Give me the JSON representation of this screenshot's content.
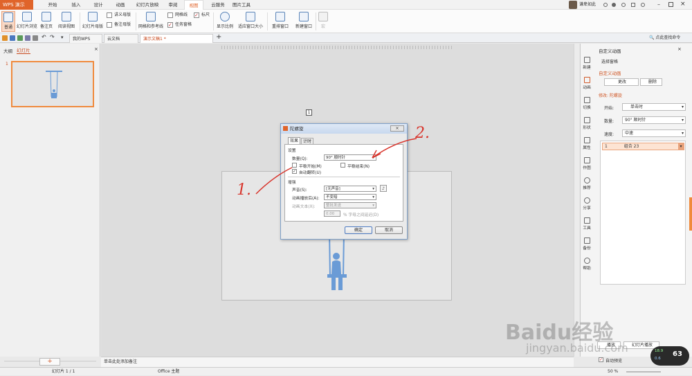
{
  "app": {
    "name": "WPS 演示",
    "user": "谦卑如此",
    "search_hint": "点此查找命令"
  },
  "menu": [
    "开始",
    "插入",
    "设计",
    "动画",
    "幻灯片放映",
    "审阅",
    "视图",
    "云服务",
    "图片工具"
  ],
  "menu_active": "视图",
  "ribbon": {
    "normal": "普通",
    "slide_browse": "幻灯片浏览",
    "notes_page": "备注页",
    "reading_view": "阅读视图",
    "slide_master": "幻灯片母版",
    "handout_master": "讲义母版",
    "notes_master": "备注母版",
    "grid_guides": "网格和参考线",
    "gridlines": "网格线",
    "ruler": "标尺",
    "task_pane": "任务窗格",
    "display_ratio": "显示比例",
    "fit_window": "适应窗口大小",
    "arrange_window": "重排窗口",
    "new_window": "新建窗口",
    "macro": "宏"
  },
  "doctabs": [
    "我的WPS",
    "云文档",
    "演示文稿1 *"
  ],
  "left_panel": {
    "tab_outline": "大纲",
    "tab_slides": "幻灯片",
    "slide_number": "1"
  },
  "canvas": {
    "marker": "1",
    "notes_hint": "单击此处添加备注"
  },
  "dialog": {
    "title": "陀螺旋",
    "tab_effect": "效果",
    "tab_timing": "计时",
    "group_settings": "设置",
    "amount_label": "数量(Q):",
    "amount_value": "90°  顺时针",
    "smooth_start": "平稳开始(M)",
    "smooth_end": "平稳结束(N)",
    "auto_reverse": "自动翻转(U)",
    "group_enhance": "增强",
    "sound_label": "声音(S):",
    "sound_value": "[无声音]",
    "after_anim_label": "动画播放后(A):",
    "after_anim_value": "不变暗",
    "anim_text_label": "动画文本(X):",
    "anim_text_value": "整批发送",
    "delay_value": "0.00",
    "delay_unit": "% 字母之间延迟(D)",
    "ok": "确定",
    "cancel": "取消"
  },
  "right_panel": {
    "header": "自定义动画",
    "select_pane": "选择窗格",
    "section_title": "自定义动画",
    "change_btn": "更改",
    "delete_btn": "删除",
    "modify_label": "修改: 陀螺旋",
    "start_label": "开始:",
    "start_value": "单击时",
    "amount_label": "数量:",
    "amount_value": "90° 顺时针",
    "speed_label": "速度:",
    "speed_value": "中速",
    "anim_item_num": "1",
    "anim_item_name": "组合 23",
    "play_btn": "播放",
    "slideshow_btn": "幻灯片播放",
    "auto_preview": "自动预览",
    "side_icons": [
      "新建",
      "动画",
      "切换",
      "形状",
      "属性",
      "作图",
      "推荐",
      "分享",
      "工具",
      "备份",
      "帮助"
    ]
  },
  "status": {
    "slide_count": "幻灯片 1 / 1",
    "theme": "Office 主题",
    "zoom": "50 %"
  },
  "annotations": [
    "1.",
    "2."
  ],
  "watermark": {
    "logo": "Baidu经验",
    "url": "jingyan.baidu.com"
  },
  "monitor": {
    "value": "63",
    "up": "18.9",
    "down": "0.6"
  }
}
